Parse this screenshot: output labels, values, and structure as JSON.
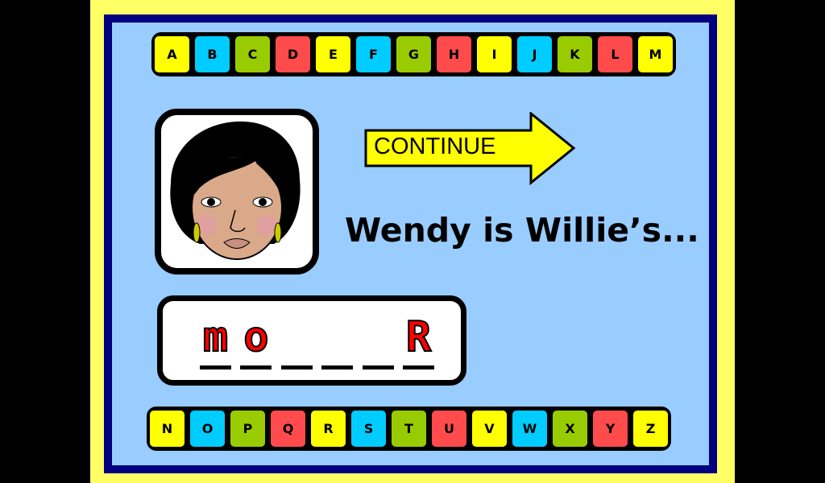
{
  "colors": {
    "yellow": "#ffff00",
    "cyan": "#00ccff",
    "green": "#99cc00",
    "red": "#ff4b4b"
  },
  "keys_top": [
    "A",
    "B",
    "C",
    "D",
    "E",
    "F",
    "G",
    "H",
    "I",
    "J",
    "K",
    "L",
    "M"
  ],
  "keys_bottom": [
    "N",
    "O",
    "P",
    "Q",
    "R",
    "S",
    "T",
    "U",
    "V",
    "W",
    "X",
    "Y",
    "Z"
  ],
  "continue_label": "CONTINUE",
  "prompt": "Wendy is Willie’s...",
  "answer_slots": [
    "m",
    "o",
    "",
    "",
    "",
    "R"
  ],
  "picture": "woman-face"
}
